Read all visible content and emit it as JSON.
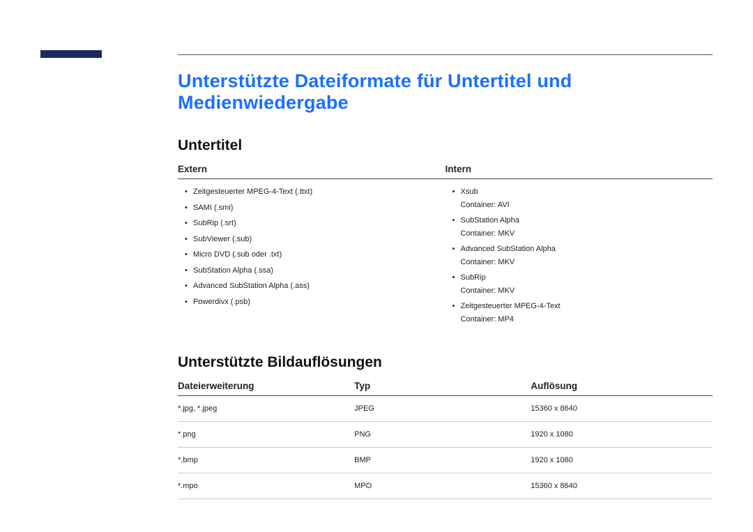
{
  "page_title": "Unterstützte Dateiformate für Untertitel und Medienwiedergabe",
  "subtitle_section": {
    "heading": "Untertitel",
    "columns": {
      "extern_label": "Extern",
      "intern_label": "Intern"
    },
    "extern_items": [
      {
        "text": "Zeitgesteuerter MPEG-4-Text (.ttxt)"
      },
      {
        "text": "SAMI (.smi)"
      },
      {
        "text": "SubRip (.srt)"
      },
      {
        "text": "SubViewer (.sub)"
      },
      {
        "text": "Micro DVD (.sub oder .txt)"
      },
      {
        "text": "SubStation Alpha (.ssa)"
      },
      {
        "text": "Advanced SubStation Alpha (.ass)"
      },
      {
        "text": "Powerdivx (.psb)"
      }
    ],
    "intern_items": [
      {
        "text": "Xsub",
        "sub": "Container: AVI"
      },
      {
        "text": "SubStation Alpha",
        "sub": "Container: MKV"
      },
      {
        "text": "Advanced SubStation Alpha",
        "sub": "Container: MKV"
      },
      {
        "text": "SubRip",
        "sub": "Container: MKV"
      },
      {
        "text": "Zeitgesteuerter MPEG-4-Text",
        "sub": "Container: MP4"
      }
    ]
  },
  "image_section": {
    "heading": "Unterstützte Bildauflösungen",
    "headers": {
      "ext": "Dateierweiterung",
      "type": "Typ",
      "res": "Auflösung"
    },
    "rows": [
      {
        "ext": "*.jpg, *.jpeg",
        "type": "JPEG",
        "res": "15360 x 8640"
      },
      {
        "ext": "*.png",
        "type": "PNG",
        "res": "1920 x 1080"
      },
      {
        "ext": "*.bmp",
        "type": "BMP",
        "res": "1920 x 1080"
      },
      {
        "ext": "*.mpo",
        "type": "MPO",
        "res": "15360 x 8640"
      }
    ]
  }
}
